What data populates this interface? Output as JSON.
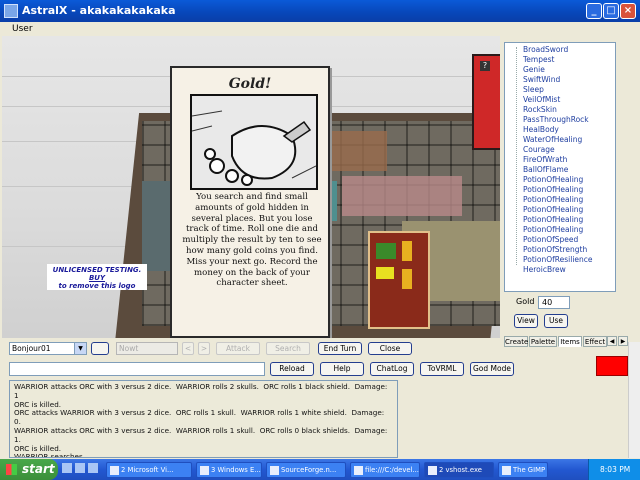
{
  "window": {
    "title": "AstralX - akakakakakaka",
    "buttons": [
      "_",
      "□",
      "×"
    ]
  },
  "menubar": {
    "items": [
      "User"
    ]
  },
  "viewport": {
    "card": {
      "title": "Gold!",
      "text": "You search and find small amounts of gold hidden in several places. But you lose track of time. Roll one die and multiply the result by ten to see how many gold coins you find. Miss your next go. Record the money on the back of your character sheet."
    },
    "watermark": {
      "line1": "UNLICENSED TESTING.",
      "line2": "BUY",
      "line3": "to remove this logo"
    }
  },
  "item_list": [
    "BroadSword",
    "Tempest",
    "Genie",
    "SwiftWind",
    "Sleep",
    "VeilOfMist",
    "RockSkin",
    "PassThroughRock",
    "HealBody",
    "WaterOfHealing",
    "Courage",
    "FireOfWrath",
    "BallOfFlame",
    "PotionOfHealing",
    "PotionOfHealing",
    "PotionOfHealing",
    "PotionOfHealing",
    "PotionOfHealing",
    "PotionOfHealing",
    "PotionOfSpeed",
    "PotionOfStrength",
    "PotionOfResilience",
    "HeroicBrew"
  ],
  "gold": {
    "label": "Gold",
    "value": "40"
  },
  "panel_buttons": {
    "view": "View",
    "use": "Use"
  },
  "tabs": [
    "Create",
    "Palette",
    "Items",
    "Effect"
  ],
  "active_tab": "Items",
  "controls_row1": {
    "combo_value": "Bonjour01",
    "name_placeholder": "Nowt",
    "disabled_small": [
      "<",
      ">"
    ],
    "attack": "Attack",
    "search": "Search",
    "end_turn": "End Turn",
    "close": "Close"
  },
  "controls_row2": {
    "reload": "Reload",
    "help": "Help",
    "chatlog": "ChatLog",
    "tovrml": "ToVRML",
    "god_mode": "God Mode"
  },
  "indicator_color": "#ff0000",
  "log_lines": [
    "WARRIOR attacks ORC with 3 versus 2 dice.  WARRIOR rolls 2 skulls.  ORC rolls 1 black shield.  Damage: 1",
    "ORC is killed.",
    "ORC attacks WARRIOR with 3 versus 2 dice.  ORC rolls 1 skull.  WARRIOR rolls 1 white shield.  Damage: 0.",
    "WARRIOR attacks ORC with 3 versus 2 dice.  WARRIOR rolls 1 skull.  ORC rolls 0 black shields.  Damage: 1.",
    "ORC is killed.",
    "WARRIOR searches..."
  ],
  "taskbar": {
    "start": "start",
    "tasks": [
      "2 Microsoft Vi...",
      "3 Windows E...",
      "SourceForge.n...",
      "file:///C:/devel...",
      "2 vshost.exe",
      "The GIMP"
    ],
    "active_task": "2 vshost.exe",
    "clock": "8:03 PM"
  }
}
